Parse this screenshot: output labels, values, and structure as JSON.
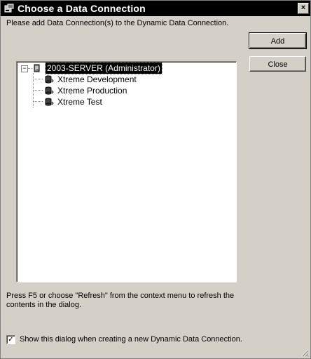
{
  "window": {
    "title": "Choose a Data Connection",
    "close_glyph": "×"
  },
  "instruction": "Please add Data Connection(s) to the Dynamic Data Connection.",
  "buttons": {
    "add": "Add",
    "close": "Close"
  },
  "tree": {
    "expander_glyph": "−",
    "root": {
      "label": "2003-SERVER (Administrator)",
      "icon": "server-icon",
      "selected": true
    },
    "children": [
      {
        "label": "Xtreme Development",
        "icon": "database-icon"
      },
      {
        "label": "Xtreme Production",
        "icon": "database-icon"
      },
      {
        "label": "Xtreme Test",
        "icon": "database-icon"
      }
    ]
  },
  "hint": "Press F5 or choose \"Refresh\" from the context menu to refresh the contents in the dialog.",
  "show_on_create": {
    "checked": true,
    "check_glyph": "✓",
    "label": "Show this dialog when creating a new Dynamic Data Connection."
  },
  "colors": {
    "titlebar": "#000000",
    "dialog": "#d4d0c8",
    "tree_bg": "#ffffff",
    "selection": "#000000"
  }
}
